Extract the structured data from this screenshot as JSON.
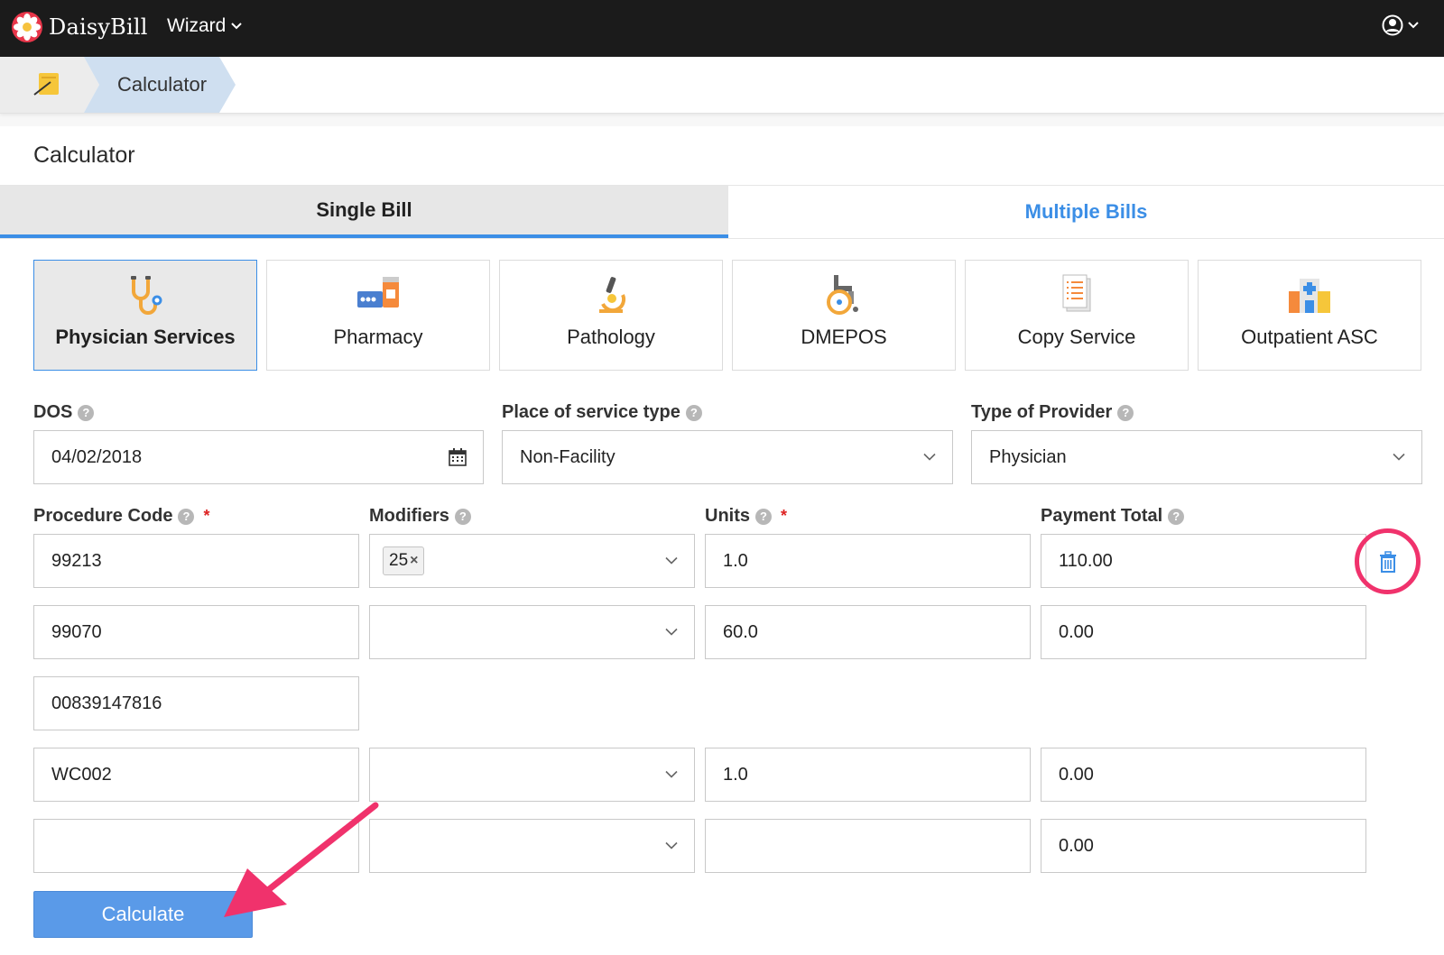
{
  "brand": {
    "name": "DaisyBill"
  },
  "nav": {
    "wizard_label": "Wizard"
  },
  "breadcrumb": {
    "current": "Calculator"
  },
  "panel": {
    "title": "Calculator"
  },
  "tabs": [
    {
      "label": "Single Bill",
      "active": true
    },
    {
      "label": "Multiple Bills",
      "active": false
    }
  ],
  "services": [
    {
      "label": "Physician Services",
      "icon": "stethoscope-icon",
      "active": true
    },
    {
      "label": "Pharmacy",
      "icon": "pills-icon",
      "active": false
    },
    {
      "label": "Pathology",
      "icon": "microscope-icon",
      "active": false
    },
    {
      "label": "DMEPOS",
      "icon": "wheelchair-icon",
      "active": false
    },
    {
      "label": "Copy Service",
      "icon": "document-icon",
      "active": false
    },
    {
      "label": "Outpatient ASC",
      "icon": "hospital-icon",
      "active": false
    }
  ],
  "form": {
    "dos": {
      "label": "DOS",
      "value": "04/02/2018"
    },
    "place_of_service": {
      "label": "Place of service type",
      "value": "Non-Facility"
    },
    "provider_type": {
      "label": "Type of Provider",
      "value": "Physician"
    },
    "columns": {
      "procedure": "Procedure Code",
      "modifiers": "Modifiers",
      "units": "Units",
      "payment": "Payment Total"
    },
    "rows": [
      {
        "code": "99213",
        "modifier": "25",
        "units": "1.0",
        "payment": "110.00"
      },
      {
        "code": "99070",
        "modifier": "",
        "units": "60.0",
        "payment": "0.00"
      },
      {
        "code": "00839147816"
      },
      {
        "code": "WC002",
        "modifier": "",
        "units": "1.0",
        "payment": "0.00"
      },
      {
        "code": "",
        "modifier": "",
        "units": "",
        "payment": "0.00"
      }
    ]
  },
  "actions": {
    "calculate_label": "Calculate"
  },
  "colors": {
    "accent": "#3b8ee6",
    "highlight": "#f0326c",
    "button": "#5a9ae8"
  }
}
